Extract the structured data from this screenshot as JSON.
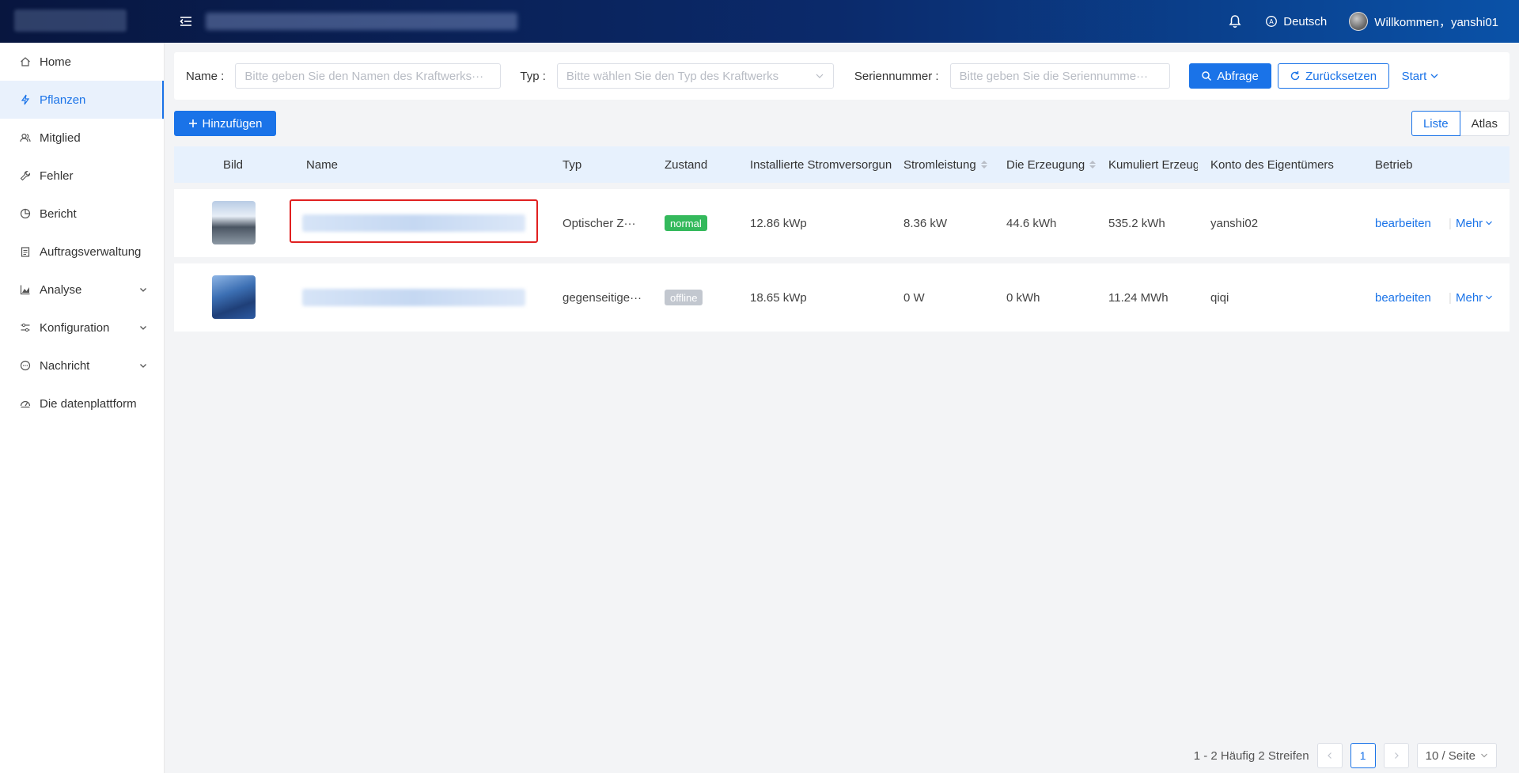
{
  "header": {
    "language_label": "Deutsch",
    "welcome_label": "Willkommen，yanshi01"
  },
  "sidebar": {
    "items": [
      {
        "label": "Home",
        "icon": "home-icon"
      },
      {
        "label": "Pflanzen",
        "icon": "bolt-icon",
        "active": true
      },
      {
        "label": "Mitglied",
        "icon": "users-icon"
      },
      {
        "label": "Fehler",
        "icon": "wrench-icon"
      },
      {
        "label": "Bericht",
        "icon": "pie-chart-icon"
      },
      {
        "label": "Auftragsverwaltung",
        "icon": "clipboard-icon"
      },
      {
        "label": "Analyse",
        "icon": "area-chart-icon",
        "expandable": true
      },
      {
        "label": "Konfiguration",
        "icon": "sliders-icon",
        "expandable": true
      },
      {
        "label": "Nachricht",
        "icon": "message-icon",
        "expandable": true
      },
      {
        "label": "Die datenplattform",
        "icon": "dashboard-icon"
      }
    ]
  },
  "filter": {
    "name_label": "Name :",
    "name_placeholder": "Bitte geben Sie den Namen des Kraftwerks···",
    "type_label": "Typ :",
    "type_placeholder": "Bitte wählen Sie den Typ des Kraftwerks",
    "serial_label": "Seriennummer :",
    "serial_placeholder": "Bitte geben Sie die Seriennumme···",
    "search_button": "Abfrage",
    "reset_button": "Zurücksetzen",
    "expand_link": "Start"
  },
  "toolbar": {
    "add_button": "Hinzufügen",
    "view_list": "Liste",
    "view_atlas": "Atlas"
  },
  "table": {
    "columns": [
      "Bild",
      "Name",
      "Typ",
      "Zustand",
      "Installierte Stromversorgun",
      "Stromleistung",
      "Die Erzeugung",
      "Kumuliert Erzeug",
      "Konto des Eigentümers",
      "Betrieb"
    ],
    "rows": [
      {
        "type": "Optischer Z···",
        "status": "normal",
        "installed": "12.86 kWp",
        "power": "8.36 kW",
        "generation": "44.6 kWh",
        "cumulative": "535.2 kWh",
        "owner": "yanshi02",
        "edit": "bearbeiten",
        "more": "Mehr"
      },
      {
        "type": "gegenseitige···",
        "status": "offline",
        "installed": "18.65 kWp",
        "power": "0 W",
        "generation": "0 kWh",
        "cumulative": "11.24 MWh",
        "owner": "qiqi",
        "edit": "bearbeiten",
        "more": "Mehr"
      }
    ]
  },
  "pagination": {
    "summary": "1 - 2 Häufig 2 Streifen",
    "current_page": "1",
    "page_size": "10 / Seite"
  },
  "colors": {
    "accent": "#1a73e8",
    "status_normal": "#34b95c",
    "status_offline": "#c2c7cf",
    "highlight": "#e02020"
  }
}
